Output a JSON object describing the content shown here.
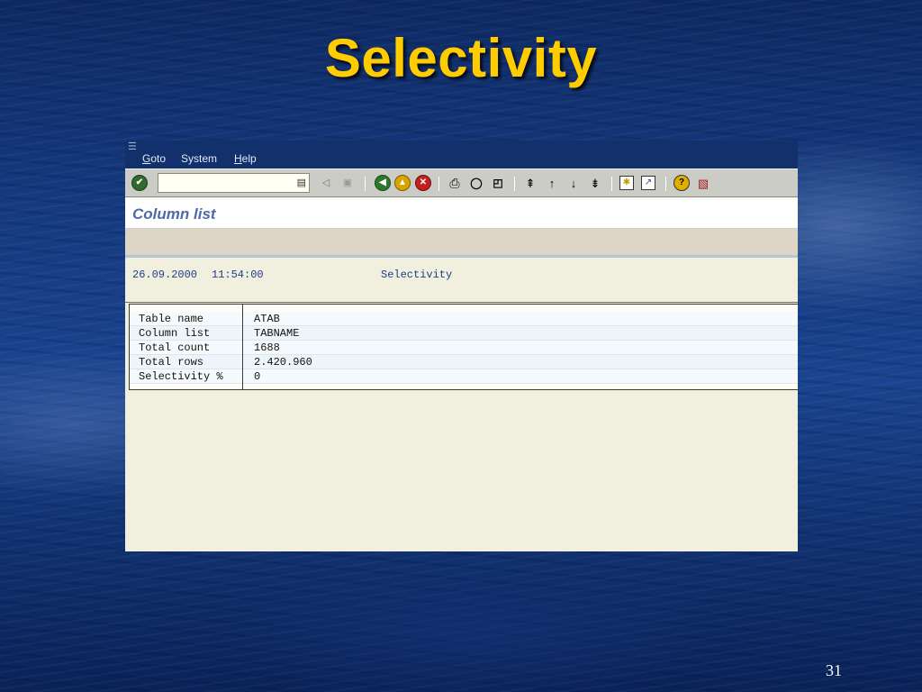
{
  "slide": {
    "title": "Selectivity",
    "page_number": "31"
  },
  "menubar": {
    "items": [
      {
        "mnemonic": "G",
        "rest": "oto"
      },
      {
        "mnemonic": "",
        "rest": "System"
      },
      {
        "mnemonic": "H",
        "rest": "elp"
      }
    ]
  },
  "toolbar": {
    "command_field_value": "",
    "icons": [
      "enter-icon",
      "history-icon",
      "back-arrow-icon",
      "save-icon",
      "back-icon",
      "exit-icon",
      "cancel-icon",
      "print-icon",
      "find-icon",
      "find-next-icon",
      "first-page-icon",
      "previous-page-icon",
      "next-page-icon",
      "last-page-icon",
      "create-session-icon",
      "shortcut-icon",
      "help-icon",
      "layout-icon"
    ]
  },
  "screen": {
    "title": "Column list"
  },
  "list": {
    "date": "26.09.2000",
    "time": "11:54:00",
    "report_title": "Selectivity",
    "rows": [
      {
        "label": "Table name",
        "value": "ATAB"
      },
      {
        "label": "Column list",
        "value": "TABNAME"
      },
      {
        "label": "Total count",
        "value": "1688"
      },
      {
        "label": "Total rows",
        "value": "2.420.960"
      },
      {
        "label": "Selectivity %",
        "value": "0"
      }
    ]
  },
  "colors": {
    "title": "#ffcc00",
    "menubar": "#12306c",
    "list_text": "#1e3c8a",
    "screen_title": "#4d6ba8"
  }
}
